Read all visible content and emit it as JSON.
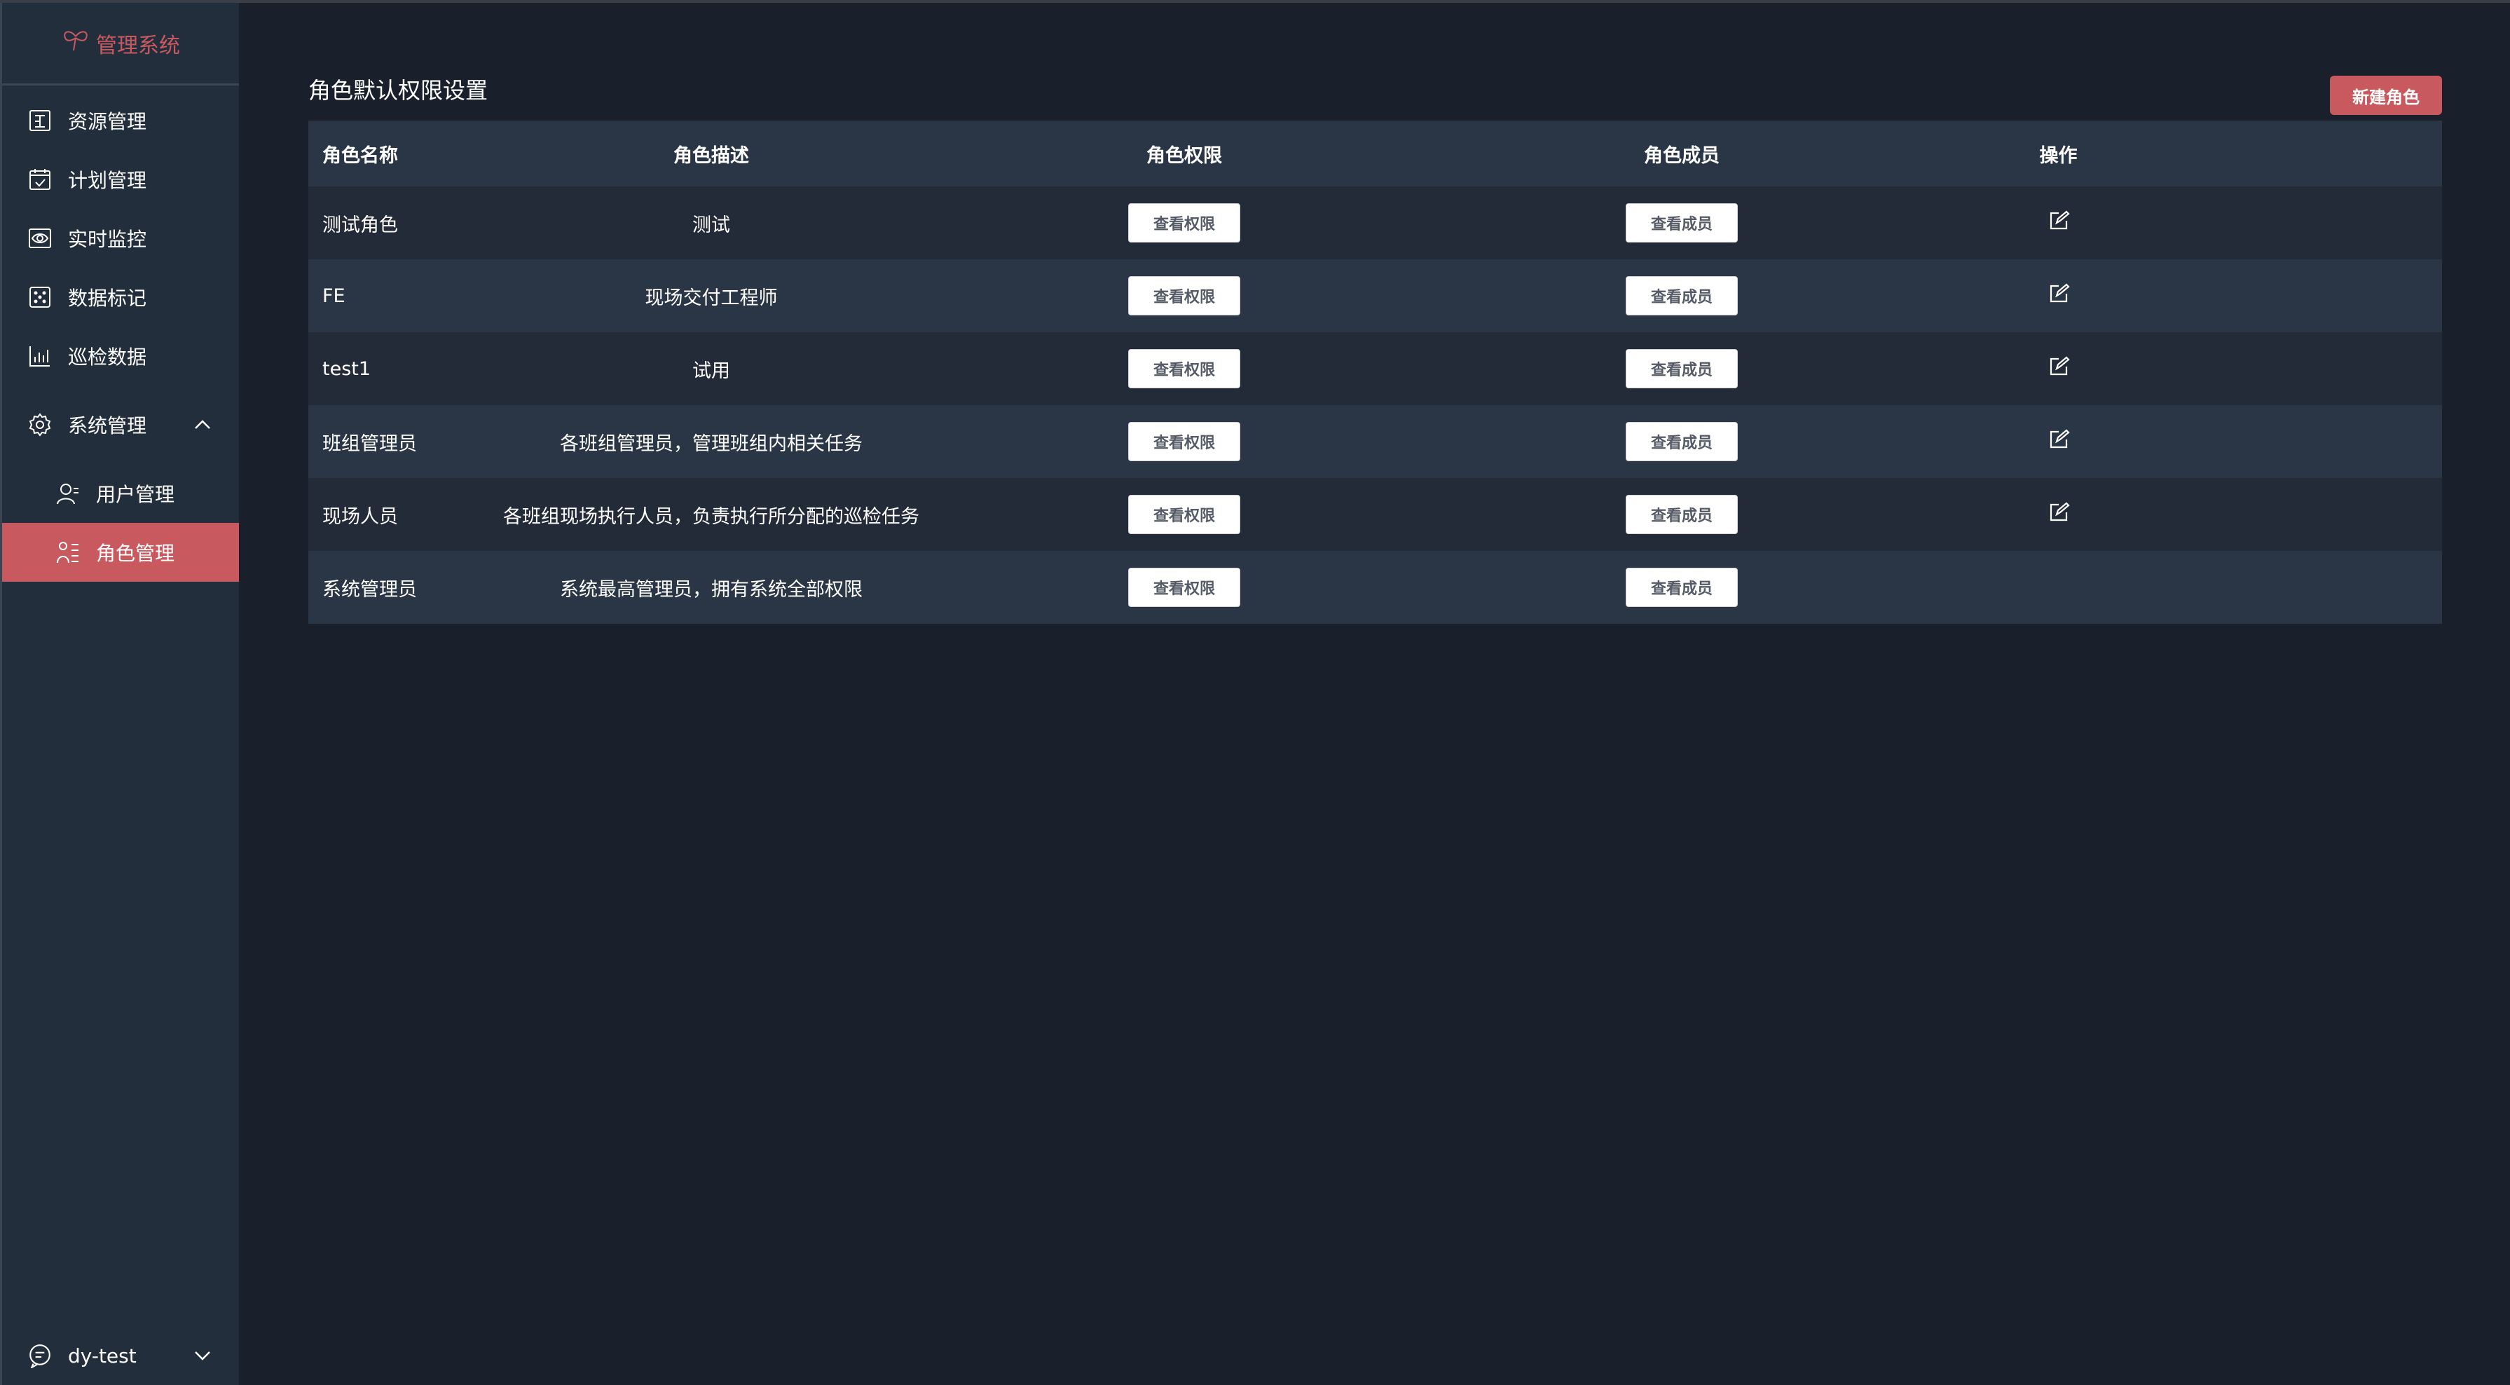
{
  "brand": {
    "name": "管理系统",
    "icon": "butterfly-logo-icon",
    "color": "#c85a5f"
  },
  "sidebar": {
    "items": [
      {
        "label": "资源管理",
        "icon": "resource-icon"
      },
      {
        "label": "计划管理",
        "icon": "calendar-check-icon"
      },
      {
        "label": "实时监控",
        "icon": "eye-monitor-icon"
      },
      {
        "label": "数据标记",
        "icon": "grid-tag-icon"
      },
      {
        "label": "巡检数据",
        "icon": "bar-chart-icon"
      },
      {
        "label": "系统管理",
        "icon": "gear-icon",
        "expanded": true
      },
      {
        "label": "用户管理",
        "icon": "user-icon"
      },
      {
        "label": "角色管理",
        "icon": "role-icon",
        "active": true
      }
    ],
    "user": {
      "name": "dy-test",
      "icon": "chat-bubble-icon"
    }
  },
  "page": {
    "title": "角色默认权限设置",
    "new_button": "新建角色"
  },
  "table": {
    "headers": [
      "角色名称",
      "角色描述",
      "角色权限",
      "角色成员",
      "操作"
    ],
    "view_perm_label": "查看权限",
    "view_member_label": "查看成员",
    "rows": [
      {
        "name": "测试角色",
        "desc": "测试",
        "editable": true
      },
      {
        "name": "FE",
        "desc": "现场交付工程师",
        "editable": true
      },
      {
        "name": "test1",
        "desc": "试用",
        "editable": true
      },
      {
        "name": "班组管理员",
        "desc": "各班组管理员，管理班组内相关任务",
        "editable": true
      },
      {
        "name": "现场人员",
        "desc": "各班组现场执行人员，负责执行所分配的巡检任务",
        "editable": true
      },
      {
        "name": "系统管理员",
        "desc": "系统最高管理员，拥有系统全部权限",
        "editable": false
      }
    ]
  },
  "colors": {
    "accent": "#c85a5f",
    "sidebar_bg": "#232e3d",
    "main_bg": "#1a202b"
  }
}
